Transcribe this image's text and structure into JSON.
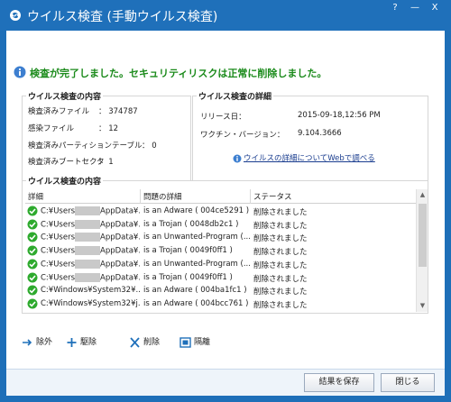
{
  "window": {
    "title": "ウイルス検査 (手動ウイルス検査)",
    "help_label": "?",
    "minimize_label": "—",
    "close_label": "X"
  },
  "status": {
    "message": "検査が完了しました。セキュリティリスクは正常に削除しました。"
  },
  "summary": {
    "title": "ウイルス検査の内容",
    "rows": [
      {
        "label": "検査済みファイル",
        "value": "： 374787"
      },
      {
        "label": "感染ファイル",
        "value": "： 12"
      },
      {
        "label": "検査済みパーティションテーブル",
        "value": "： 0"
      },
      {
        "label": "検査済みブートセクタ",
        "value": "： 1"
      }
    ]
  },
  "details": {
    "title": "ウイルス検査の詳細",
    "release_label": "リリース日：",
    "release_value": "2015-09-18,12:56 PM",
    "vaccine_label": "ワクチン・バージョン：",
    "vaccine_value": "9.104.3666",
    "web_link": "ウイルスの詳細についてWebで調べる"
  },
  "results": {
    "title": "ウイルス検査の内容",
    "columns": [
      "詳細",
      "問題の詳細",
      "ステータス"
    ],
    "rows": [
      {
        "path_a": "C:¥Users",
        "path_b": "AppData¥...",
        "problem": "is an Adware ( 004ce5291 )",
        "status": "削除されました"
      },
      {
        "path_a": "C:¥Users",
        "path_b": "AppData¥...",
        "problem": "is a Trojan ( 0048db2c1 )",
        "status": "削除されました"
      },
      {
        "path_a": "C:¥Users",
        "path_b": "AppData¥...",
        "problem": "is an Unwanted-Program (...",
        "status": "削除されました"
      },
      {
        "path_a": "C:¥Users",
        "path_b": "AppData¥...",
        "problem": "is a Trojan ( 0049f0ff1 )",
        "status": "削除されました"
      },
      {
        "path_a": "C:¥Users",
        "path_b": "AppData¥...",
        "problem": "is an Unwanted-Program (...",
        "status": "削除されました"
      },
      {
        "path_a": "C:¥Users",
        "path_b": "AppData¥...",
        "problem": "is a Trojan ( 0049f0ff1 )",
        "status": "削除されました"
      },
      {
        "path_a": "C:¥Windows¥System32¥...",
        "path_b": "",
        "problem": "is an Adware ( 004ba1fc1 )",
        "status": "削除されました"
      },
      {
        "path_a": "C:¥Windows¥System32¥j...",
        "path_b": "",
        "problem": "is an Adware ( 004bcc761 )",
        "status": "削除されました"
      }
    ]
  },
  "actions": {
    "exclude": "除外",
    "remove": "駆除",
    "delete": "削除",
    "quarantine": "隔離"
  },
  "buttons": {
    "save": "結果を保存",
    "close": "閉じる"
  },
  "colors": {
    "titlebar": "#1f70ba",
    "status_text": "#1a8a1a",
    "link": "#1a3d8f",
    "check": "#2eaa2e"
  }
}
